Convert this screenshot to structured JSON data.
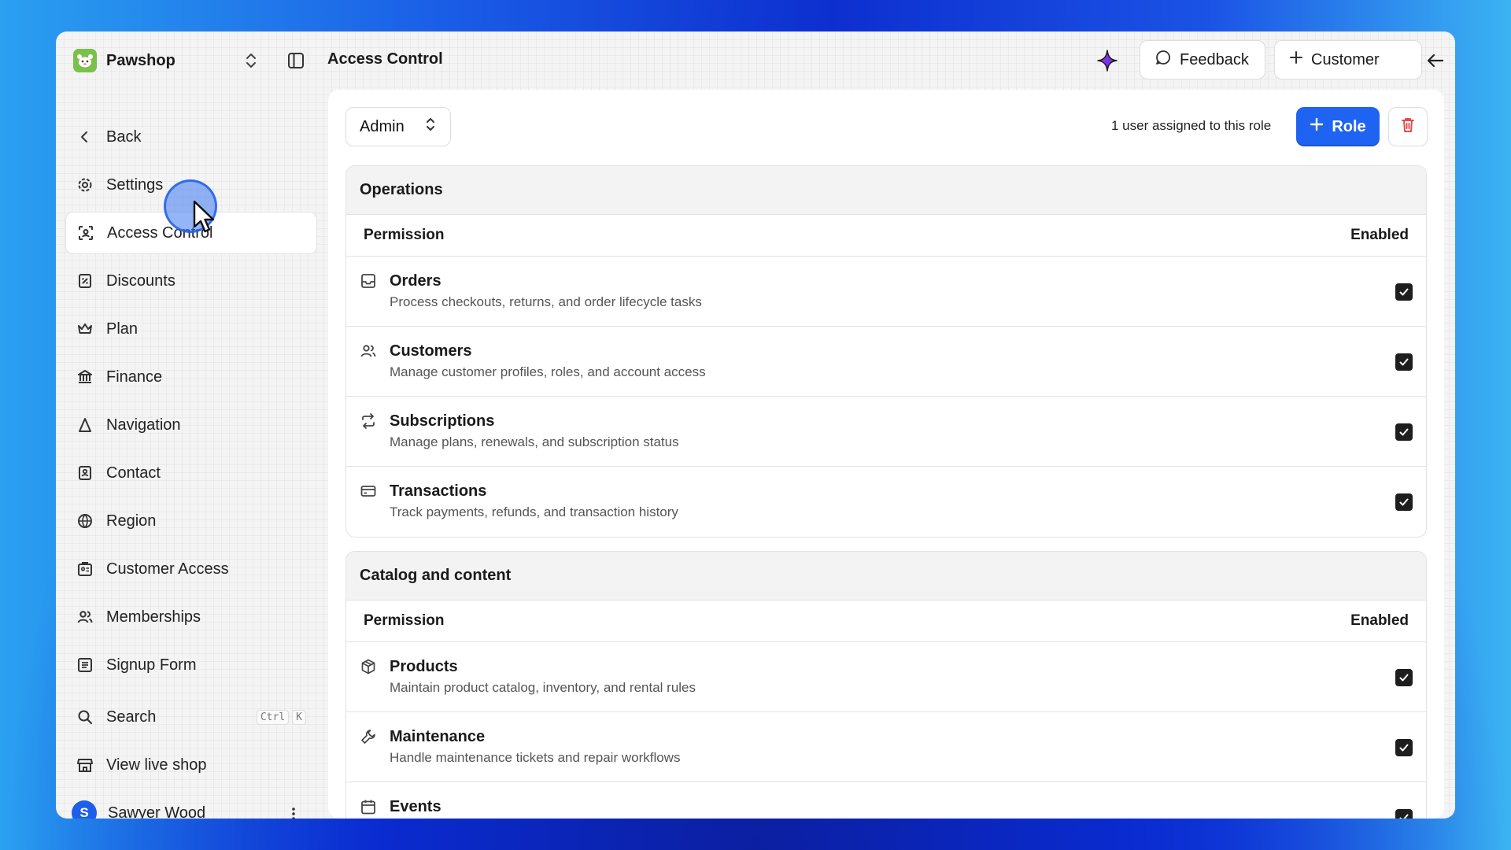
{
  "app": {
    "name": "Pawshop",
    "page_title": "Access Control",
    "feedback_label": "Feedback",
    "customer_label": "Customer"
  },
  "sidebar": {
    "items": [
      {
        "label": "Back",
        "icon": "chevron-left-icon"
      },
      {
        "label": "Settings",
        "icon": "gear-icon"
      },
      {
        "label": "Access Control",
        "icon": "scan-face-icon",
        "active": true
      },
      {
        "label": "Discounts",
        "icon": "discount-icon"
      },
      {
        "label": "Plan",
        "icon": "crown-icon"
      },
      {
        "label": "Finance",
        "icon": "bank-icon"
      },
      {
        "label": "Navigation",
        "icon": "navigation-icon"
      },
      {
        "label": "Contact",
        "icon": "contact-book-icon"
      },
      {
        "label": "Region",
        "icon": "globe-icon"
      },
      {
        "label": "Customer Access",
        "icon": "customer-access-icon"
      },
      {
        "label": "Memberships",
        "icon": "users-icon"
      },
      {
        "label": "Signup Form",
        "icon": "form-icon"
      }
    ],
    "search_label": "Search",
    "search_shortcut": [
      "Ctrl",
      "K"
    ],
    "view_shop_label": "View live shop",
    "user": {
      "initial": "S",
      "name": "Sawyer Wood"
    }
  },
  "main": {
    "role_select": "Admin",
    "assigned_text": "1 user assigned to this role",
    "add_role_label": "Role",
    "sections": [
      {
        "title": "Operations",
        "col_permission": "Permission",
        "col_enabled": "Enabled",
        "rows": [
          {
            "title": "Orders",
            "desc": "Process checkouts, returns, and order lifecycle tasks",
            "enabled": true,
            "icon": "inbox-icon"
          },
          {
            "title": "Customers",
            "desc": "Manage customer profiles, roles, and account access",
            "enabled": true,
            "icon": "users-icon"
          },
          {
            "title": "Subscriptions",
            "desc": "Manage plans, renewals, and subscription status",
            "enabled": true,
            "icon": "repeat-icon"
          },
          {
            "title": "Transactions",
            "desc": "Track payments, refunds, and transaction history",
            "enabled": true,
            "icon": "credit-card-icon"
          }
        ]
      },
      {
        "title": "Catalog and content",
        "col_permission": "Permission",
        "col_enabled": "Enabled",
        "rows": [
          {
            "title": "Products",
            "desc": "Maintain product catalog, inventory, and rental rules",
            "enabled": true,
            "icon": "package-icon"
          },
          {
            "title": "Maintenance",
            "desc": "Handle maintenance tickets and repair workflows",
            "enabled": true,
            "icon": "wrench-icon"
          },
          {
            "title": "Events",
            "desc": "",
            "enabled": true,
            "icon": "calendar-icon"
          }
        ]
      }
    ]
  },
  "colors": {
    "accent": "#1f63f2",
    "brand_logo": "#7cc04b",
    "danger": "#e5484d"
  }
}
